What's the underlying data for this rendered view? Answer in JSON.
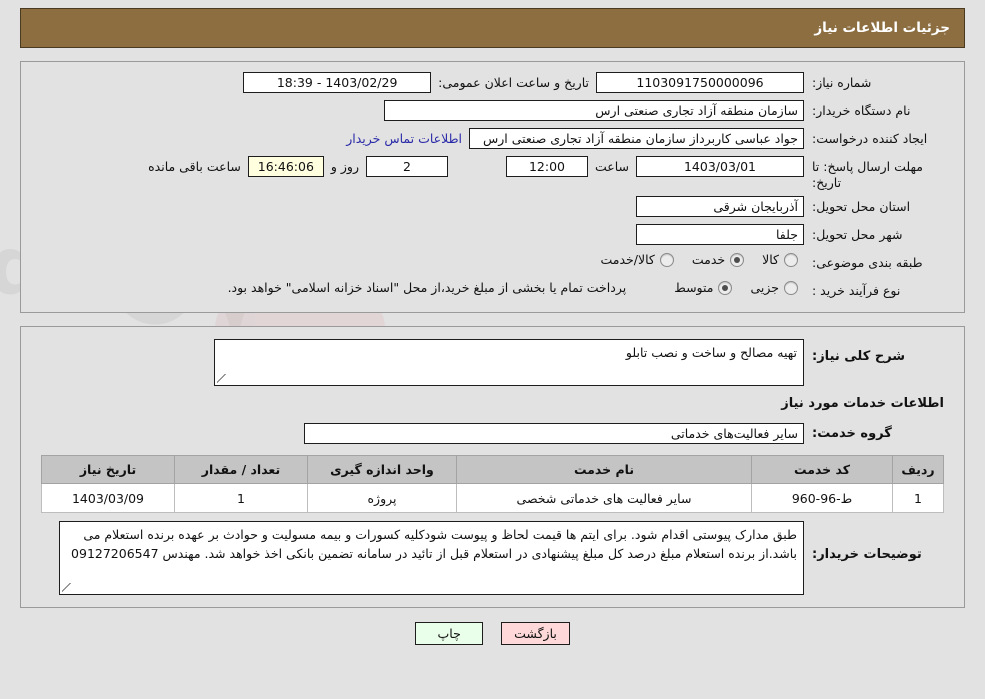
{
  "header": {
    "title": "جزئیات اطلاعات نیاز",
    "bar_color": "#8c6e41"
  },
  "info": {
    "need_number_label": "شماره نیاز:",
    "need_number": "1103091750000096",
    "announce_label": "تاریخ و ساعت اعلان عمومی:",
    "announce_value": "1403/02/29 - 18:39",
    "buyer_org_label": "نام دستگاه خریدار:",
    "buyer_org": "سازمان منطقه آزاد تجاری صنعتی ارس",
    "creator_label": "ایجاد کننده درخواست:",
    "creator": "جواد عباسی کاربرداز سازمان منطقه آزاد تجاری صنعتی ارس",
    "contact_link": "اطلاعات تماس خریدار",
    "deadline_label": "مهلت ارسال پاسخ: تا تاریخ:",
    "deadline_date": "1403/03/01",
    "hour_label": "ساعت",
    "deadline_time": "12:00",
    "days_value": "2",
    "days_label": "روز و",
    "countdown": "16:46:06",
    "countdown_label": "ساعت باقی مانده",
    "province_label": "استان محل تحویل:",
    "province": "آذربایجان شرقی",
    "city_label": "شهر محل تحویل:",
    "city": "جلفا",
    "category_label": "طبقه بندی موضوعی:",
    "category_options": [
      {
        "label": "کالا",
        "selected": false
      },
      {
        "label": "خدمت",
        "selected": true
      },
      {
        "label": "کالا/خدمت",
        "selected": false
      }
    ],
    "process_label": "نوع فرآیند خرید :",
    "process_options": [
      {
        "label": "جزیی",
        "selected": false
      },
      {
        "label": "متوسط",
        "selected": true
      }
    ],
    "process_note": "پرداخت تمام یا بخشی از مبلغ خرید،از محل \"اسناد خزانه اسلامی\" خواهد بود."
  },
  "description": {
    "label": "شرح کلی نیاز:",
    "value": "تهیه مصالح و ساخت و نصب تابلو"
  },
  "services": {
    "section_title": "اطلاعات خدمات مورد نیاز",
    "group_label": "گروه خدمت:",
    "group_value": "سایر فعالیت‌های خدماتی",
    "table": {
      "columns": [
        "ردیف",
        "کد خدمت",
        "نام خدمت",
        "واحد اندازه گیری",
        "تعداد / مقدار",
        "تاریخ نیاز"
      ],
      "rows": [
        {
          "index": "1",
          "code": "ط-96-960",
          "name": "سایر فعالیت های خدماتی شخصی",
          "unit": "پروژه",
          "quantity": "1",
          "need_date": "1403/03/09"
        }
      ]
    }
  },
  "buyer_notes": {
    "label": "توضیحات خریدار:",
    "value": "طبق مدارک پیوستی اقدام شود. برای ایتم ها قیمت لحاظ و پیوست شودکلیه کسورات و بیمه مسولیت و حوادث بر عهده برنده استعلام می باشد.از برنده استعلام مبلغ  درصد کل مبلغ پیشنهادی در استعلام قبل از تائید در سامانه تضمین بانکی اخذ خواهد شد. مهندس 09127206547"
  },
  "footer": {
    "print_label": "چاپ",
    "back_label": "بازگشت"
  },
  "watermark": {
    "text": "AriaTender.net"
  }
}
